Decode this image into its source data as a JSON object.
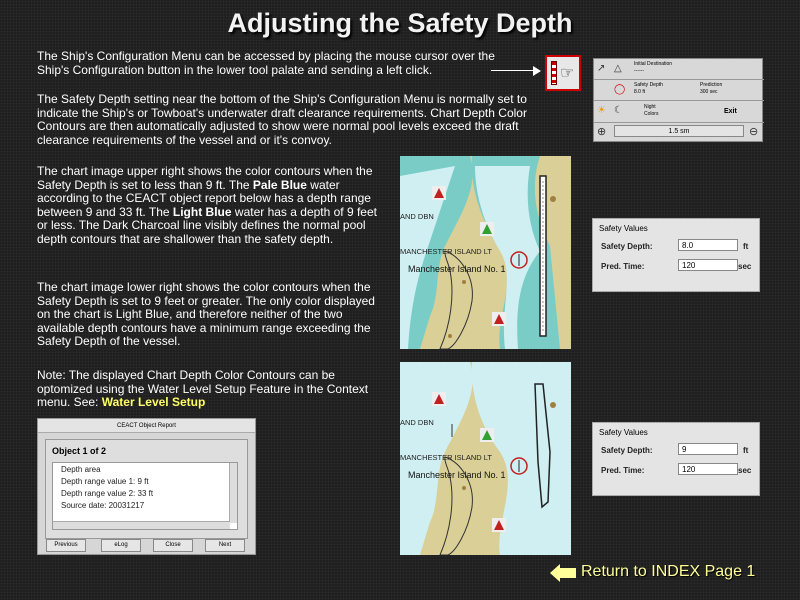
{
  "page": {
    "title": "Adjusting the Safety Depth",
    "para1": "The Ship's Configuration Menu can be accessed by placing the mouse cursor over the Ship's Configuration button in the lower tool palate and sending a left click.",
    "para2": "The Safety Depth setting near the bottom of the Ship's Configuration Menu is normally set to indicate the Ship's or Towboat's underwater draft clearance requirements. Chart Depth Color Contours are then automatically adjusted to show were normal pool levels exceed the draft clearance requirements of the vessel and or it's convoy.",
    "para3_a": "The chart image upper right shows the color contours when the Safety Depth is set to less than 9 ft.  The ",
    "para3_b": "Pale Blue",
    "para3_c": " water according to the CEACT object report below has a depth range between 9 and 33 ft.  The ",
    "para3_d": "Light Blue",
    "para3_e": " water has a depth of 9 feet or less.  The Dark Charcoal line visibly defines the normal pool depth contours that are shallower than the safety depth.",
    "para4": "The chart image lower right shows the color contours when the Safety Depth is set to 9 feet or greater.  The only color displayed on the chart is Light Blue, and therefore neither of the two available depth contours have a minimum range exceeding the Safety Depth of the vessel.",
    "para5_a": "Note:  The displayed Chart Depth Color Contours can be optomized using the Water Level Setup Feature in the Context menu.   See: ",
    "para5_link": "Water Level Setup",
    "return_link": "Return to INDEX Page 1"
  },
  "toolbar": {
    "row1_label": "Initial Destination",
    "row1_value": "------",
    "safety_label": "Safety Depth",
    "safety_value": "8.0 ft",
    "prediction_label": "Prediction",
    "prediction_value": "300 sec",
    "night_label": "Night",
    "colors_label": "Colors",
    "exit_label": "Exit",
    "zoom_value": "1.5 sm"
  },
  "maps": {
    "label_dbn": "AND DBN",
    "label_lt": "MANCHESTER ISLAND LT",
    "label_island": "Manchester Island No. 1"
  },
  "safety_top": {
    "title": "Safety Values",
    "depth_label": "Safety Depth:",
    "depth_value": "8.0",
    "depth_unit": "ft",
    "pred_label": "Pred. Time:",
    "pred_value": "120",
    "pred_unit": "sec"
  },
  "safety_bottom": {
    "title": "Safety Values",
    "depth_label": "Safety Depth:",
    "depth_value": "9",
    "depth_unit": "ft",
    "pred_label": "Pred. Time:",
    "pred_value": "120",
    "pred_unit": "sec"
  },
  "dialog": {
    "title": "CEACT Object Report",
    "object": "Object 1 of 2",
    "lines": [
      "Depth area",
      "Depth range value 1: 9 ft",
      "Depth range value 2: 33 ft",
      "Source date: 20031217"
    ],
    "buttons": {
      "previous": "Previous",
      "elog": "eLog",
      "close": "Close",
      "next": "Next"
    }
  },
  "colors": {
    "pale_blue": "#cfeff2",
    "light_blue": "#79cdc6",
    "land": "#d9cf97",
    "accent_yellow": "#ffff99"
  }
}
